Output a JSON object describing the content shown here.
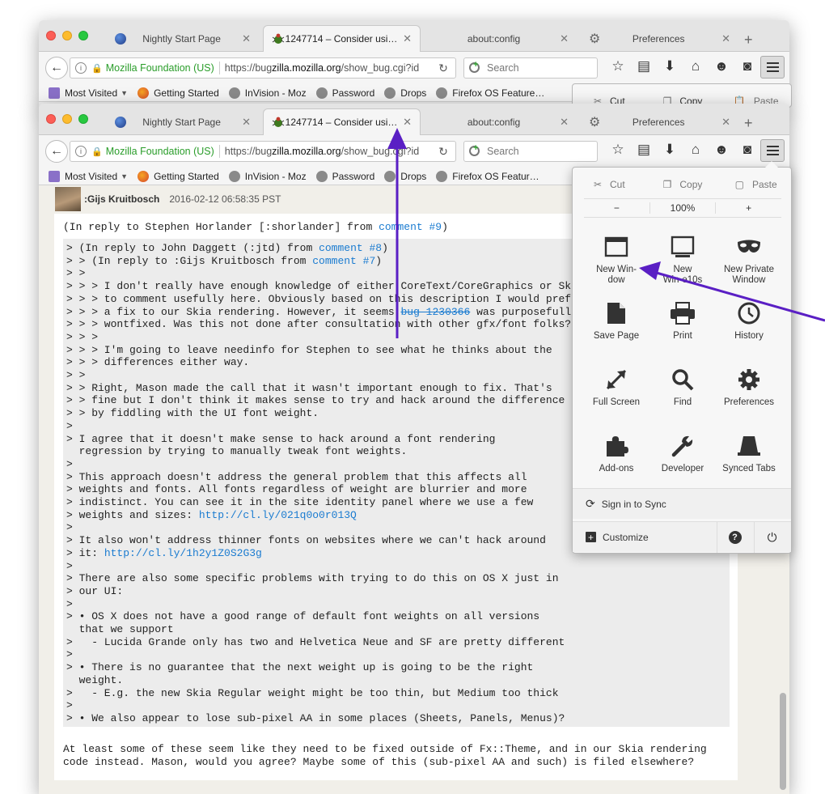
{
  "tabs": [
    {
      "title": "Nightly Start Page"
    },
    {
      "title": "1247714 – Consider usi…"
    },
    {
      "title": "about:config"
    },
    {
      "title": "Preferences"
    }
  ],
  "navbar": {
    "identity": "Mozilla Foundation (US)",
    "url_prefix": "https://bug",
    "url_domain": "zilla.mozilla.org",
    "url_path": "/show_bug.cgi?id",
    "search_placeholder": "Search"
  },
  "bookmarks": [
    "Most Visited",
    "Getting Started",
    "InVision - Moz",
    "Password",
    "Drops",
    "Firefox OS Feature…",
    "Firefox OS Featur…"
  ],
  "comment": {
    "author": ":Gijs Kruitbosch",
    "date": "2016-02-12 06:58:35 PST",
    "reply_prefix": "(In reply to Stephen Horlander [:shorlander] from ",
    "reply_link": "comment #9",
    "reply_suffix": ")",
    "quote": [
      {
        "t": "> (In reply to John Daggett (:jtd) from ",
        "l": "comment #8",
        "a": ")"
      },
      {
        "t": "> > (In reply to :Gijs Kruitbosch from ",
        "l": "comment #7",
        "a": ")"
      },
      {
        "t": "> >"
      },
      {
        "t": "> > > I don't really have enough knowledge of either CoreText/CoreGraphics or Ski"
      },
      {
        "t": "> > > to comment usefully here. Obviously based on this description I would pref"
      },
      {
        "t": "> > > a fix to our Skia rendering. However, it seems ",
        "s": "bug 1230366",
        "a": " was purposefull"
      },
      {
        "t": "> > > wontfixed. Was this not done after consultation with other gfx/font folks?"
      },
      {
        "t": "> > >"
      },
      {
        "t": "> > > I'm going to leave needinfo for Stephen to see what he thinks about the"
      },
      {
        "t": "> > > differences either way."
      },
      {
        "t": "> >"
      },
      {
        "t": "> > Right, Mason made the call that it wasn't important enough to fix. That's"
      },
      {
        "t": "> > fine but I don't think it makes sense to try and hack around the difference"
      },
      {
        "t": "> > by fiddling with the UI font weight."
      },
      {
        "t": ">"
      },
      {
        "t": "> I agree that it doesn't make sense to hack around a font rendering"
      },
      {
        "t": "  regression by trying to manually tweak font weights."
      },
      {
        "t": ">"
      },
      {
        "t": "> This approach doesn't address the general problem that this affects all"
      },
      {
        "t": "> weights and fonts. All fonts regardless of weight are blurrier and more"
      },
      {
        "t": "> indistinct. You can see it in the site identity panel where we use a few"
      },
      {
        "t": "> weights and sizes: ",
        "l": "http://cl.ly/021q0o0r013Q"
      },
      {
        "t": ">"
      },
      {
        "t": "> It also won't address thinner fonts on websites where we can't hack around"
      },
      {
        "t": "> it: ",
        "l": "http://cl.ly/1h2y1Z0S2G3g"
      },
      {
        "t": ">"
      },
      {
        "t": "> There are also some specific problems with trying to do this on OS X just in"
      },
      {
        "t": "> our UI:"
      },
      {
        "t": ">"
      },
      {
        "t": "> • OS X does not have a good range of default font weights on all versions"
      },
      {
        "t": "  that we support"
      },
      {
        "t": ">   - Lucida Grande only has two and Helvetica Neue and SF are pretty different"
      },
      {
        "t": ">"
      },
      {
        "t": "> • There is no guarantee that the next weight up is going to be the right"
      },
      {
        "t": "  weight."
      },
      {
        "t": ">   - E.g. the new Skia Regular weight might be too thin, but Medium too thick"
      },
      {
        "t": ">"
      },
      {
        "t": "> • We also appear to lose sub-pixel AA in some places (Sheets, Panels, Menus)?"
      }
    ],
    "tail": [
      "At least some of these seem like they need to be fixed outside of Fx::Theme, and in our Skia rendering",
      "code instead. Mason, would you agree? Maybe some of this (sub-pixel AA and such) is filed elsewhere?"
    ]
  },
  "menu": {
    "edit": {
      "cut": "Cut",
      "copy": "Copy",
      "paste": "Paste"
    },
    "zoom": {
      "minus": "−",
      "level": "100%",
      "plus": "+"
    },
    "items": [
      {
        "label": "New Win-\ndow",
        "icon": "new-window-icon"
      },
      {
        "label": "New\nWin-e10s",
        "icon": "new-e10s-window-icon"
      },
      {
        "label": "New Private\nWindow",
        "icon": "private-mask-icon"
      },
      {
        "label": "Save Page",
        "icon": "save-page-icon"
      },
      {
        "label": "Print",
        "icon": "printer-icon"
      },
      {
        "label": "History",
        "icon": "history-clock-icon"
      },
      {
        "label": "Full Screen",
        "icon": "fullscreen-arrows-icon"
      },
      {
        "label": "Find",
        "icon": "magnifier-icon"
      },
      {
        "label": "Preferences",
        "icon": "gear-icon"
      },
      {
        "label": "Add-ons",
        "icon": "puzzle-piece-icon"
      },
      {
        "label": "Developer",
        "icon": "wrench-icon"
      },
      {
        "label": "Synced Tabs",
        "icon": "synced-tabs-icon"
      }
    ],
    "sync_label": "Sign in to Sync",
    "customize_label": "Customize"
  },
  "colors": {
    "annotation_arrow": "#5a1fc4",
    "link": "#1a7bd0",
    "secure_green": "#2a9d2a"
  }
}
